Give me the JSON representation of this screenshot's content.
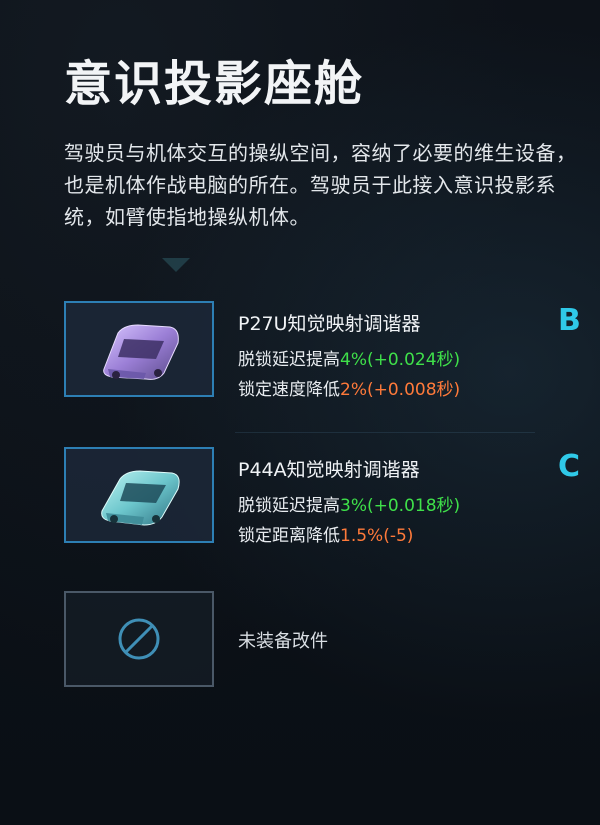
{
  "panel": {
    "title": "意识投影座舱",
    "description": "驾驶员与机体交互的操纵空间，容纳了必要的维生设备，也是机体作战电脑的所在。驾驶员于此接入意识投影系统，如臂使指地操纵机体。"
  },
  "modules": [
    {
      "name": "P27U知觉映射调谐器",
      "grade": "B",
      "stat1_label": "脱锁延迟提高",
      "stat1_value": "4%(+0.024秒)",
      "stat2_label": "锁定速度降低",
      "stat2_value": "2%(+0.008秒)",
      "icon": "purple-car-part-icon",
      "color": "#b49ae0"
    },
    {
      "name": "P44A知觉映射调谐器",
      "grade": "C",
      "stat1_label": "脱锁延迟提高",
      "stat1_value": "3%(+0.018秒)",
      "stat2_label": "锁定距离降低",
      "stat2_value": "1.5%(-5)",
      "icon": "teal-car-part-icon",
      "color": "#7fd6d6"
    }
  ],
  "empty_slot": {
    "label": "未装备改件",
    "icon": "prohibited-icon"
  },
  "colors": {
    "positive": "#3fe04a",
    "negative": "#ff7a3a",
    "grade": "#2fc9e8",
    "slot_border": "#2d7fb4"
  }
}
